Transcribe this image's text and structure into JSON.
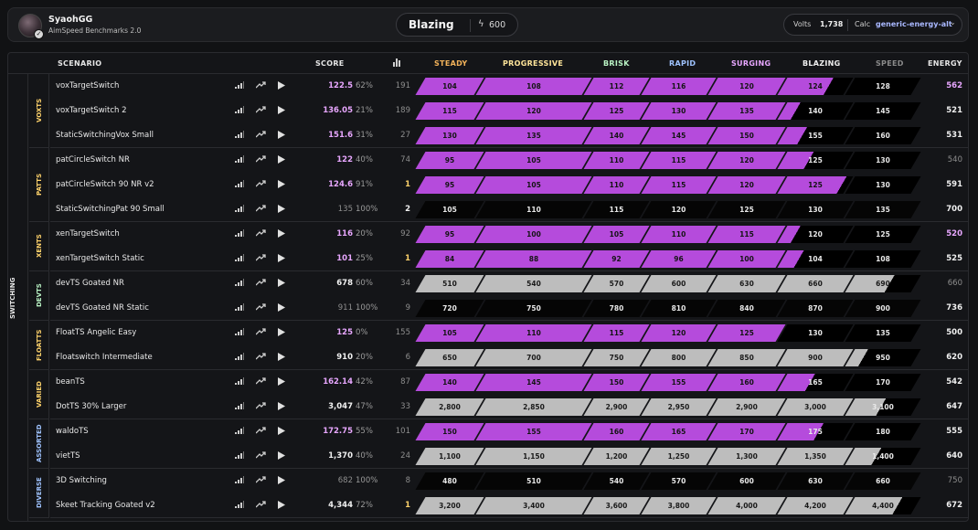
{
  "user": {
    "name": "SyaohGG",
    "subtitle": "AimSpeed Benchmarks 2.0"
  },
  "rank": {
    "name": "Blazing",
    "energy": "600"
  },
  "volts": {
    "label": "Volts",
    "value": "1,738"
  },
  "calc": {
    "label": "Calc",
    "value": "generic-energy-alt"
  },
  "headers": {
    "scenario": "SCENARIO",
    "score": "SCORE",
    "tiers": [
      "STEADY",
      "PROGRESSIVE",
      "BRISK",
      "RAPID",
      "SURGING",
      "BLAZING",
      "SPEED"
    ],
    "energy": "ENERGY"
  },
  "colors": {
    "accent": "#b54bdc",
    "steady": "#f2b25a",
    "progressive": "#ffe59a",
    "brisk": "#b9f3c4",
    "rapid": "#9fc3ff",
    "surging": "#e8a7ff",
    "blazing": "#f0f0f0",
    "speed": "#8a8a8a"
  },
  "category": "SWITCHING",
  "groups": [
    {
      "name": "VOXTS",
      "color": "#ffd36b"
    },
    {
      "name": "PATTS",
      "color": "#ffd36b"
    },
    {
      "name": "XENTS",
      "color": "#ffd36b"
    },
    {
      "name": "DEVTS",
      "color": "#b9f3c4"
    },
    {
      "name": "FLOATTS",
      "color": "#ffd36b"
    },
    {
      "name": "VARIED",
      "color": "#ffd36b"
    },
    {
      "name": "ASSORTED",
      "color": "#9fc3ff"
    },
    {
      "name": "DIVERSE",
      "color": "#9fc3ff"
    }
  ],
  "rows": [
    {
      "name": "voxTargetSwitch",
      "score": "122.5",
      "pct": "62%",
      "rank": "191",
      "tiers": [
        "104",
        "108",
        "112",
        "116",
        "120",
        "124",
        "128"
      ],
      "energy": "562",
      "fill": 5.7,
      "scoreColor": "purple",
      "energyColor": "purple"
    },
    {
      "name": "voxTargetSwitch 2",
      "score": "136.05",
      "pct": "21%",
      "rank": "189",
      "tiers": [
        "115",
        "120",
        "125",
        "130",
        "135",
        "140",
        "145"
      ],
      "energy": "521",
      "fill": 5.2
    },
    {
      "name": "StaticSwitchingVox Small",
      "score": "151.6",
      "pct": "31%",
      "rank": "27",
      "tiers": [
        "130",
        "135",
        "140",
        "145",
        "150",
        "155",
        "160"
      ],
      "energy": "531",
      "fill": 5.3
    },
    {
      "name": "patCircleSwitch NR",
      "score": "122",
      "pct": "40%",
      "rank": "74",
      "tiers": [
        "95",
        "105",
        "110",
        "115",
        "120",
        "125",
        "130"
      ],
      "energy": "540",
      "fill": 5.4,
      "dimEnergy": true
    },
    {
      "name": "patCircleSwitch 90 NR v2",
      "score": "124.6",
      "pct": "91%",
      "rank": "1",
      "tiers": [
        "95",
        "105",
        "110",
        "115",
        "120",
        "125",
        "130"
      ],
      "energy": "591",
      "fill": 5.9,
      "goldRank": true
    },
    {
      "name": "StaticSwitchingPat 90 Small",
      "score": "135",
      "pct": "100%",
      "rank": "2",
      "tiers": [
        "105",
        "110",
        "115",
        "120",
        "125",
        "130",
        "135"
      ],
      "energy": "700",
      "fill": 0,
      "dimScore": true,
      "whiteRank": true
    },
    {
      "name": "xenTargetSwitch",
      "score": "116",
      "pct": "20%",
      "rank": "92",
      "tiers": [
        "95",
        "100",
        "105",
        "110",
        "115",
        "120",
        "125"
      ],
      "energy": "520",
      "fill": 5.2,
      "energyColor": "purple"
    },
    {
      "name": "xenTargetSwitch Static",
      "score": "101",
      "pct": "25%",
      "rank": "1",
      "tiers": [
        "84",
        "88",
        "92",
        "96",
        "100",
        "104",
        "108"
      ],
      "energy": "525",
      "fill": 5.25,
      "goldRank": true
    },
    {
      "name": "devTS Goated NR",
      "score": "678",
      "pct": "60%",
      "rank": "34",
      "tiers": [
        "510",
        "540",
        "570",
        "600",
        "630",
        "660",
        "690"
      ],
      "energy": "660",
      "fill": 6.6,
      "gray": true,
      "dimEnergy": true
    },
    {
      "name": "devTS Goated NR Static",
      "score": "911",
      "pct": "100%",
      "rank": "9",
      "tiers": [
        "720",
        "750",
        "780",
        "810",
        "840",
        "870",
        "900"
      ],
      "energy": "736",
      "fill": 0,
      "dimScore": true
    },
    {
      "name": "FloatTS Angelic Easy",
      "score": "125",
      "pct": "0%",
      "rank": "155",
      "tiers": [
        "105",
        "110",
        "115",
        "120",
        "125",
        "130",
        "135"
      ],
      "energy": "500",
      "fill": 5.0
    },
    {
      "name": "Floatswitch Intermediate",
      "score": "910",
      "pct": "20%",
      "rank": "6",
      "tiers": [
        "650",
        "700",
        "750",
        "800",
        "850",
        "900",
        "950"
      ],
      "energy": "620",
      "fill": 6.2,
      "gray": true
    },
    {
      "name": "beanTS",
      "score": "162.14",
      "pct": "42%",
      "rank": "87",
      "tiers": [
        "140",
        "145",
        "150",
        "155",
        "160",
        "165",
        "170"
      ],
      "energy": "542",
      "fill": 5.42
    },
    {
      "name": "DotTS 30% Larger",
      "score": "3,047",
      "pct": "47%",
      "rank": "33",
      "tiers": [
        "2,800",
        "2,850",
        "2,900",
        "2,950",
        "2,900",
        "3,000",
        "3,100"
      ],
      "energy": "647",
      "fill": 6.47,
      "gray": true
    },
    {
      "name": "waldoTS",
      "score": "172.75",
      "pct": "55%",
      "rank": "101",
      "tiers": [
        "150",
        "155",
        "160",
        "165",
        "170",
        "175",
        "180"
      ],
      "energy": "555",
      "fill": 5.55
    },
    {
      "name": "vietTS",
      "score": "1,370",
      "pct": "40%",
      "rank": "24",
      "tiers": [
        "1,100",
        "1,150",
        "1,200",
        "1,250",
        "1,300",
        "1,350",
        "1,400"
      ],
      "energy": "640",
      "fill": 6.4,
      "gray": true
    },
    {
      "name": "3D Switching",
      "score": "682",
      "pct": "100%",
      "rank": "8",
      "tiers": [
        "480",
        "510",
        "540",
        "570",
        "600",
        "630",
        "660"
      ],
      "energy": "750",
      "fill": 0,
      "dimScore": true,
      "dimEnergy": true
    },
    {
      "name": "Skeet Tracking Goated v2",
      "score": "4,344",
      "pct": "72%",
      "rank": "1",
      "tiers": [
        "3,200",
        "3,400",
        "3,600",
        "3,800",
        "4,000",
        "4,200",
        "4,400"
      ],
      "energy": "672",
      "fill": 6.72,
      "gray": true,
      "goldRank": true
    }
  ]
}
